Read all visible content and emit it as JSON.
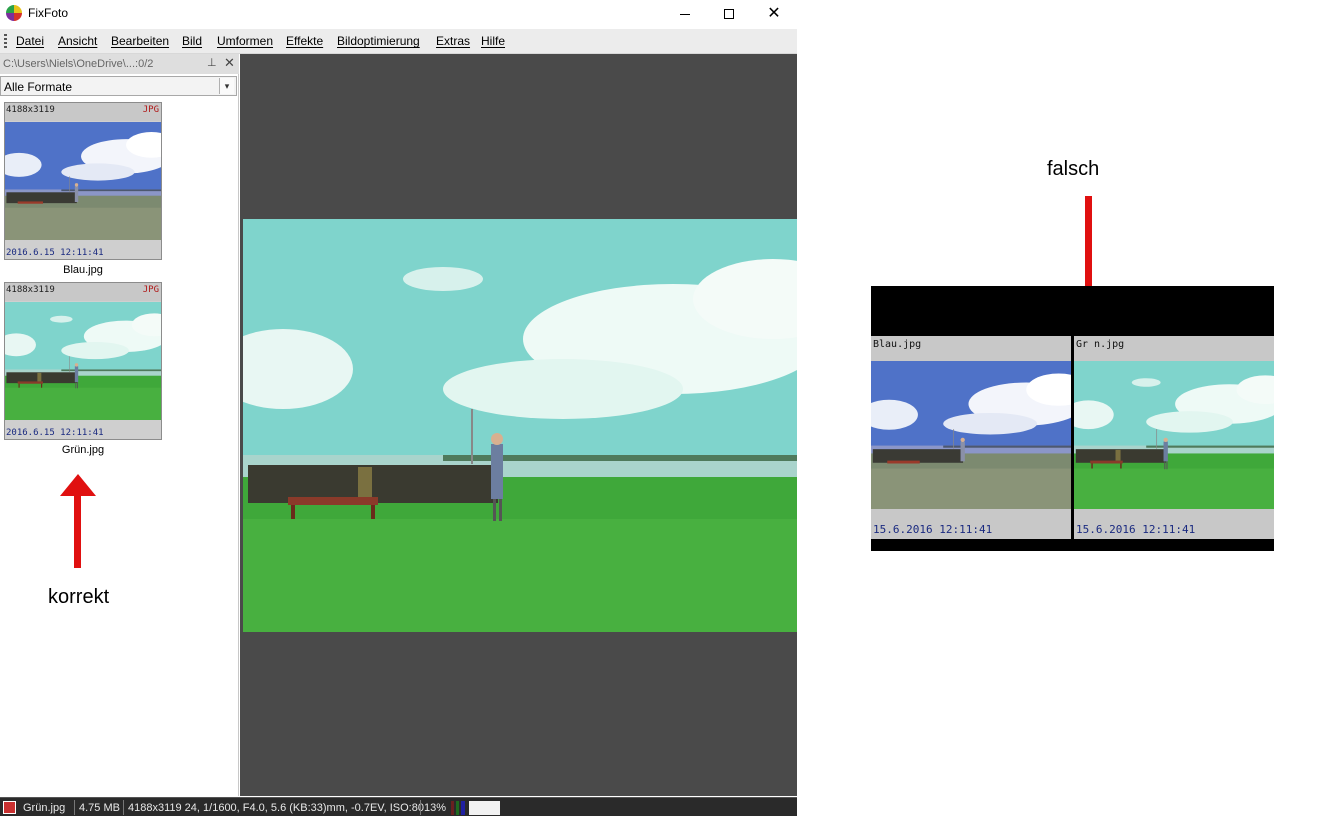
{
  "window": {
    "title": "FixFoto"
  },
  "menu": [
    "Datei",
    "Ansicht",
    "Bearbeiten",
    "Bild",
    "Umformen",
    "Effekte",
    "Bildoptimierung",
    "Extras",
    "Hilfe"
  ],
  "browser": {
    "path": "C:\\Users\\Niels\\OneDrive\\...:0/2",
    "format_filter": "Alle Formate",
    "thumbnails": [
      {
        "dims": "4188x3119",
        "format": "JPG",
        "date": "2016.6.15 12:11:41",
        "name": "Blau.jpg",
        "tint": "blue"
      },
      {
        "dims": "4188x3119",
        "format": "JPG",
        "date": "2016.6.15 12:11:41",
        "name": "Grün.jpg",
        "tint": "green"
      }
    ]
  },
  "statusbar": {
    "filename": "Grün.jpg",
    "size": "4.75 MB",
    "exif": "4188x3119 24, 1/1600, F4.0, 5.6 (KB:33)mm, -0.7EV, ISO:80",
    "zoom": "13%"
  },
  "annotations": {
    "correct": "korrekt",
    "wrong": "falsch"
  },
  "wrong_panel": {
    "cells": [
      {
        "name": "Blau.jpg",
        "date": "15.6.2016 12:11:41",
        "tint": "blue"
      },
      {
        "name": "Gr n.jpg",
        "date": "15.6.2016 12:11:41",
        "tint": "green"
      }
    ]
  },
  "colors": {
    "arrow": "#e01010",
    "viewer_bg": "#4a4a4a",
    "date_text": "#1a2a80",
    "format_text": "#b01818"
  }
}
